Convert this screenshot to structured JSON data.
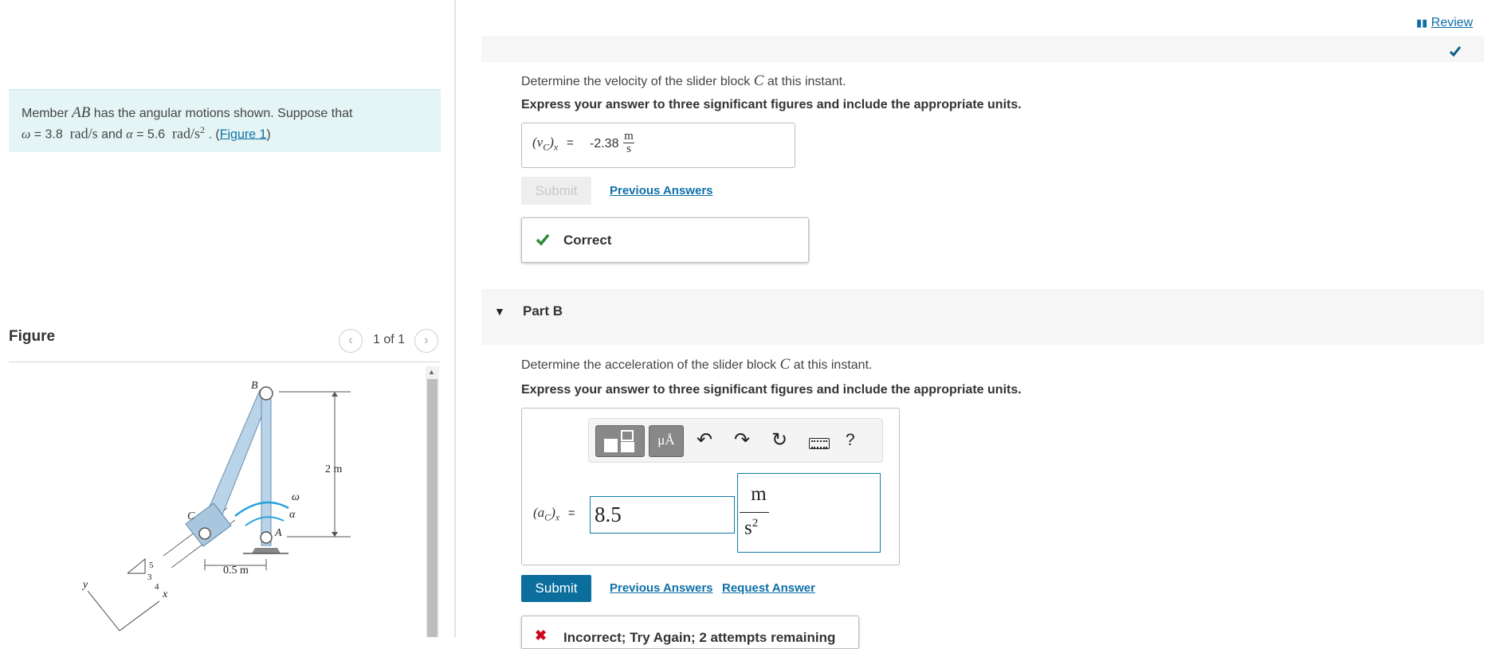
{
  "problem": {
    "t1": "Member ",
    "member": "AB",
    "t2": " has the angular motions shown. Suppose that",
    "omega_sym": "ω",
    "eq": " = ",
    "omega_val": "3.8",
    "omega_unit": "rad/s",
    "and": " and ",
    "alpha_sym": "α",
    "alpha_val": "5.6",
    "alpha_unit": "rad/s",
    "alpha_exp": "2",
    "sep": " . (",
    "figure_link": "Figure 1",
    "close": ")"
  },
  "figure": {
    "heading": "Figure",
    "pager": "1 of 1",
    "labels": {
      "B": "B",
      "C": "C",
      "A": "A",
      "omega": "ω",
      "alpha": "α",
      "dim_2m": "2 m",
      "dim_05m": "0.5 m",
      "y": "y",
      "x": "x",
      "n5": "5",
      "n3": "3",
      "n4": "4"
    }
  },
  "header": {
    "review": "Review"
  },
  "partA": {
    "question_pre": "Determine the velocity of the slider block ",
    "question_var": "C",
    "question_post": " at this instant.",
    "instruction": "Express your answer to three significant figures and include the appropriate units.",
    "answer_label_v": "(v",
    "answer_label_sub": "C",
    "answer_label_end": ")",
    "answer_label_x": "x",
    "equals": "=",
    "answer_value": "-2.38",
    "unit_num": "m",
    "unit_den": "s",
    "submit": "Submit",
    "previous_answers": "Previous Answers",
    "feedback": "Correct"
  },
  "partB": {
    "title": "Part B",
    "question_pre": "Determine the acceleration of the slider block ",
    "question_var": "C",
    "question_post": " at this instant.",
    "instruction": "Express your answer to three significant figures and include the appropriate units.",
    "answer_label_a": "(a",
    "answer_label_sub": "C",
    "answer_label_end": ")",
    "answer_label_x": "x",
    "equals": "=",
    "value_input": "8.5",
    "unit_num": "m",
    "unit_den": "s",
    "unit_exp": "2",
    "toolbar": {
      "units_glyph": "μÅ",
      "help": "?"
    },
    "submit": "Submit",
    "previous_answers": "Previous Answers",
    "request_answer": "Request Answer",
    "feedback": "Incorrect; Try Again; 2 attempts remaining"
  },
  "colors": {
    "accent": "#0b6e9c",
    "correct": "#2e8b3a",
    "incorrect": "#d0021b",
    "problem_bg": "#e5f5f5"
  }
}
